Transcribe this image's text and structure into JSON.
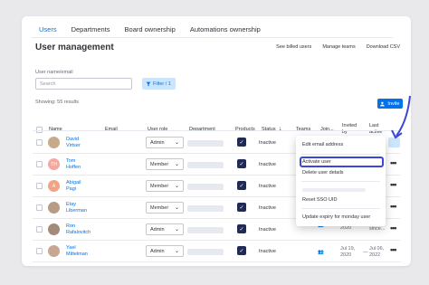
{
  "tabs": [
    "Users",
    "Departments",
    "Board ownership",
    "Automations ownership"
  ],
  "title": "User management",
  "top_links": [
    "See billed users",
    "Manage teams",
    "Download CSV"
  ],
  "search": {
    "label": "User name/email",
    "placeholder": "Search"
  },
  "filter_label": "Filter / 1",
  "showing": "Showing: 55 results",
  "invite_label": "Invite",
  "columns": [
    "Name",
    "Email",
    "User role",
    "Department",
    "Products",
    "Status",
    "Teams",
    "Join...",
    "Invited by",
    "Last active"
  ],
  "rows": [
    {
      "first": "David",
      "last": "Virtser",
      "role": "Admin",
      "status": "Inactive",
      "avatar": {
        "type": "photo",
        "color": "#c8a98a"
      }
    },
    {
      "first": "Tom",
      "last": "Hoffen",
      "role": "Member",
      "status": "Inactive",
      "avatar": {
        "type": "initials",
        "initials": "TH",
        "color": "#f4a9a0"
      }
    },
    {
      "first": "Abigail",
      "last": "Pagi",
      "role": "Member",
      "status": "Inactive",
      "avatar": {
        "type": "initials",
        "initials": "A",
        "color": "#f2a382"
      }
    },
    {
      "first": "Etay",
      "last": "Liberman",
      "role": "Member",
      "status": "Inactive",
      "avatar": {
        "type": "photo",
        "color": "#b99a86"
      }
    },
    {
      "first": "Ron",
      "last": "Rafalovitch",
      "role": "Admin",
      "status": "Inactive",
      "avatar": {
        "type": "photo",
        "color": "#a58a7a"
      }
    },
    {
      "first": "Yael",
      "last": "Mittelman",
      "role": "Admin",
      "status": "Inactive",
      "avatar": {
        "type": "photo",
        "color": "#c9a593"
      }
    }
  ],
  "row_extra": [
    {},
    {},
    {},
    {},
    {
      "joined": "Jul 19, 2020",
      "invited": "—",
      "last_active": "No activity since..."
    },
    {
      "joined": "Jul 19, 2020",
      "invited": "—",
      "last_active": "Jul 06, 2022"
    }
  ],
  "menu_items": [
    {
      "label": "Edit email address"
    },
    {
      "label": "Activate user"
    },
    {
      "label": "Delete user details"
    },
    {
      "label": "Reset SSO UID"
    },
    {
      "label": "Update expiry for monday user"
    }
  ],
  "colors": {
    "accent": "#0073ea",
    "highlight": "#3b47d6",
    "product": "#1f2a55"
  }
}
